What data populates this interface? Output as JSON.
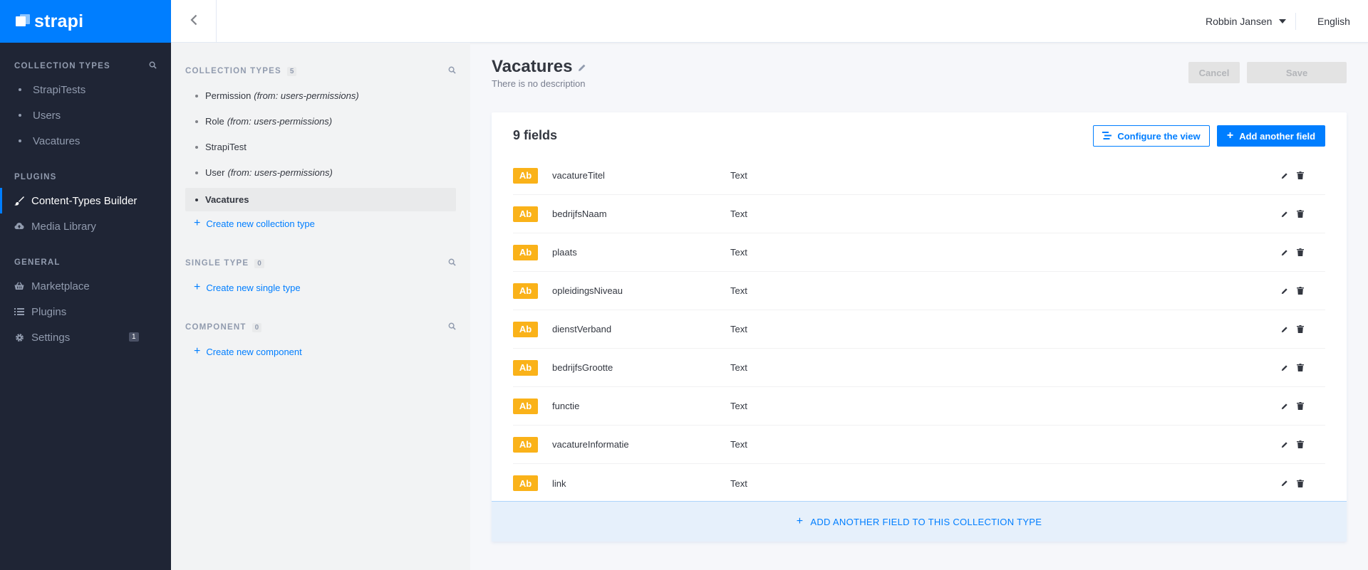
{
  "brand": {
    "name": "strapi",
    "color": "#007eff"
  },
  "leftnav": {
    "collection_types_title": "COLLECTION TYPES",
    "collection_types": [
      "StrapiTests",
      "Users",
      "Vacatures"
    ],
    "plugins_title": "PLUGINS",
    "plugins": [
      {
        "label": "Content-Types Builder",
        "icon": "paint-brush-icon",
        "active": true
      },
      {
        "label": "Media Library",
        "icon": "cloud-upload-icon",
        "active": false
      }
    ],
    "general_title": "GENERAL",
    "general": [
      {
        "label": "Marketplace",
        "icon": "shopping-basket-icon"
      },
      {
        "label": "Plugins",
        "icon": "list-icon"
      },
      {
        "label": "Settings",
        "icon": "gear-icon",
        "badge": "1"
      }
    ]
  },
  "topbar": {
    "user": "Robbin Jansen",
    "language": "English"
  },
  "ctb": {
    "collection_types": {
      "title": "COLLECTION TYPES",
      "count": "5",
      "items": [
        {
          "name": "Permission",
          "from": "(from: users-permissions)"
        },
        {
          "name": "Role",
          "from": "(from: users-permissions)"
        },
        {
          "name": "StrapiTest",
          "from": ""
        },
        {
          "name": "User",
          "from": "(from: users-permissions)"
        },
        {
          "name": "Vacatures",
          "from": ""
        }
      ],
      "create_label": "Create new collection type"
    },
    "single_type": {
      "title": "SINGLE TYPE",
      "count": "0",
      "create_label": "Create new single type"
    },
    "component": {
      "title": "COMPONENT",
      "count": "0",
      "create_label": "Create new component"
    }
  },
  "main": {
    "title": "Vacatures",
    "description": "There is no description",
    "cancel_label": "Cancel",
    "save_label": "Save",
    "fields_count_label": "9 fields",
    "configure_label": "Configure the view",
    "add_field_label": "Add another field",
    "fields": [
      {
        "name": "vacatureTitel",
        "type": "Text",
        "badge": "Ab"
      },
      {
        "name": "bedrijfsNaam",
        "type": "Text",
        "badge": "Ab"
      },
      {
        "name": "plaats",
        "type": "Text",
        "badge": "Ab"
      },
      {
        "name": "opleidingsNiveau",
        "type": "Text",
        "badge": "Ab"
      },
      {
        "name": "dienstVerband",
        "type": "Text",
        "badge": "Ab"
      },
      {
        "name": "bedrijfsGrootte",
        "type": "Text",
        "badge": "Ab"
      },
      {
        "name": "functie",
        "type": "Text",
        "badge": "Ab"
      },
      {
        "name": "vacatureInformatie",
        "type": "Text",
        "badge": "Ab"
      },
      {
        "name": "link",
        "type": "Text",
        "badge": "Ab"
      }
    ],
    "footer_label": "ADD ANOTHER FIELD TO THIS COLLECTION TYPE"
  }
}
